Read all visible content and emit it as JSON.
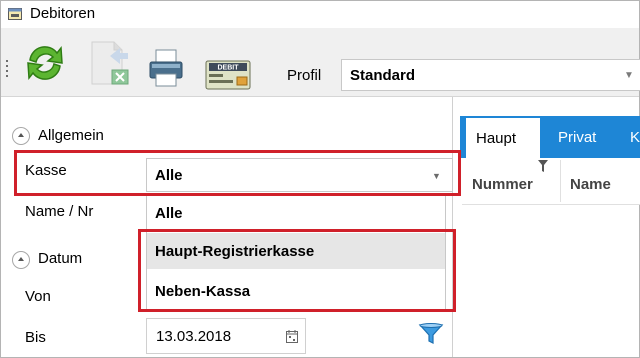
{
  "window": {
    "title": "Debitoren"
  },
  "toolbar": {
    "debit_icon_text": "DEBIT",
    "profil_label": "Profil",
    "profil_value": "Standard"
  },
  "sections": {
    "allgemein": "Allgemein",
    "datum": "Datum"
  },
  "fields": {
    "kasse_label": "Kasse",
    "kasse_value": "Alle",
    "name_label": "Name / Nr",
    "von_label": "Von",
    "bis_label": "Bis",
    "bis_value": "13.03.2018"
  },
  "kasse_options": [
    "Alle",
    "Haupt-Registrierkasse",
    "Neben-Kassa"
  ],
  "tabs": [
    "Haupt",
    "Privat",
    "K"
  ],
  "grid": {
    "columns": [
      "Nummer",
      "Name"
    ]
  },
  "colors": {
    "accent": "#1e86d6",
    "highlight": "#d0202a",
    "hover": "#e6e6e6"
  }
}
